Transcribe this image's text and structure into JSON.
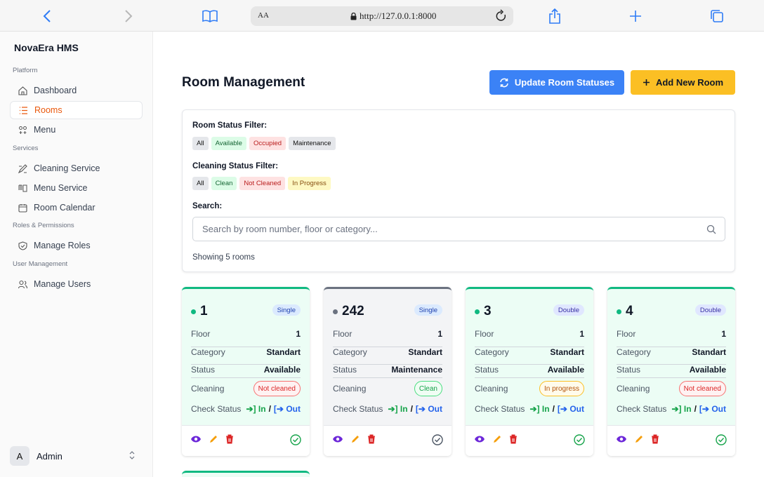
{
  "browser": {
    "url_aa": "AA",
    "url": "http://127.0.0.1:8000"
  },
  "sidebar": {
    "brand": "NovaEra HMS",
    "sections": [
      "Platform",
      "Services",
      "Roles & Permissions",
      "User Management"
    ],
    "items": [
      {
        "label": "Dashboard",
        "icon": "home-icon"
      },
      {
        "label": "Rooms",
        "icon": "list-icon",
        "active": true
      },
      {
        "label": "Menu",
        "icon": "menu-grid-icon"
      },
      {
        "label": "Cleaning Service",
        "icon": "brush-icon"
      },
      {
        "label": "Menu Service",
        "icon": "menu-service-icon"
      },
      {
        "label": "Room Calendar",
        "icon": "calendar-icon"
      },
      {
        "label": "Manage Roles",
        "icon": "shield-icon"
      },
      {
        "label": "Manage Users",
        "icon": "users-icon"
      }
    ],
    "user": {
      "initial": "A",
      "name": "Admin"
    }
  },
  "main": {
    "title": "Room Management",
    "update_btn": "Update Room Statuses",
    "add_btn": "Add New Room"
  },
  "filters": {
    "room_label": "Room Status Filter:",
    "room_chips": [
      "All",
      "Available",
      "Occupied",
      "Maintenance"
    ],
    "clean_label": "Cleaning Status Filter:",
    "clean_chips": [
      "All",
      "Clean",
      "Not Cleaned",
      "In Progress"
    ],
    "search_label": "Search:",
    "search_placeholder": "Search by room number, floor or category...",
    "showing": "Showing 5 rooms"
  },
  "card_labels": {
    "floor": "Floor",
    "category": "Category",
    "status": "Status",
    "cleaning": "Cleaning",
    "check": "Check Status",
    "in": "In",
    "sep": "/",
    "out": "Out"
  },
  "rooms": [
    {
      "number": "1",
      "type": "Single",
      "floor": "1",
      "category": "Standart",
      "status": "Available",
      "cleaning": "Not cleaned",
      "status_color": "#10b981"
    },
    {
      "number": "242",
      "type": "Single",
      "floor": "1",
      "category": "Standart",
      "status": "Maintenance",
      "cleaning": "Clean",
      "status_color": "#6b7280"
    },
    {
      "number": "3",
      "type": "Double",
      "floor": "1",
      "category": "Standart",
      "status": "Available",
      "cleaning": "In progress",
      "status_color": "#10b981"
    },
    {
      "number": "4",
      "type": "Double",
      "floor": "1",
      "category": "Standart",
      "status": "Available",
      "cleaning": "Not cleaned",
      "status_color": "#10b981"
    }
  ],
  "colors": {
    "accent_blue": "#3b82f6",
    "accent_yellow": "#fbbf24",
    "active_nav": "#ea580c",
    "available": "#10b981"
  }
}
